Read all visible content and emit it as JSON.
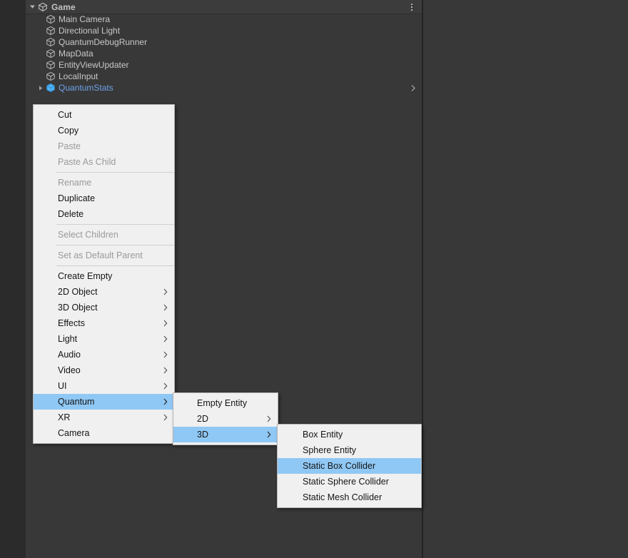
{
  "app": "Unity Editor",
  "hierarchy": {
    "header": {
      "title": "Game",
      "scene_icon": "unity-scene-icon",
      "fold_icon": "triangle-down-icon",
      "options_icon": "kebab-menu-icon"
    },
    "rows": [
      {
        "label": "Main Camera",
        "icon": "gameobject-cube-icon",
        "expandable": false,
        "prefab": false,
        "open_prefab": false
      },
      {
        "label": "Directional Light",
        "icon": "gameobject-cube-icon",
        "expandable": false,
        "prefab": false,
        "open_prefab": false
      },
      {
        "label": "QuantumDebugRunner",
        "icon": "gameobject-cube-icon",
        "expandable": false,
        "prefab": false,
        "open_prefab": false
      },
      {
        "label": "MapData",
        "icon": "gameobject-cube-icon",
        "expandable": false,
        "prefab": false,
        "open_prefab": false
      },
      {
        "label": "EntityViewUpdater",
        "icon": "gameobject-cube-icon",
        "expandable": false,
        "prefab": false,
        "open_prefab": false
      },
      {
        "label": "LocalInput",
        "icon": "gameobject-cube-icon",
        "expandable": false,
        "prefab": false,
        "open_prefab": false
      },
      {
        "label": "QuantumStats",
        "icon": "prefab-cube-icon",
        "expandable": true,
        "prefab": true,
        "open_prefab": true
      }
    ]
  },
  "context_menu": {
    "items": [
      {
        "label": "Cut",
        "state": "enabled",
        "submenu": false
      },
      {
        "label": "Copy",
        "state": "enabled",
        "submenu": false
      },
      {
        "label": "Paste",
        "state": "disabled",
        "submenu": false
      },
      {
        "label": "Paste As Child",
        "state": "disabled",
        "submenu": false
      },
      {
        "separator": true
      },
      {
        "label": "Rename",
        "state": "disabled",
        "submenu": false
      },
      {
        "label": "Duplicate",
        "state": "enabled",
        "submenu": false
      },
      {
        "label": "Delete",
        "state": "enabled",
        "submenu": false
      },
      {
        "separator": true
      },
      {
        "label": "Select Children",
        "state": "disabled",
        "submenu": false
      },
      {
        "separator": true
      },
      {
        "label": "Set as Default Parent",
        "state": "disabled",
        "submenu": false
      },
      {
        "separator": true
      },
      {
        "label": "Create Empty",
        "state": "enabled",
        "submenu": false
      },
      {
        "label": "2D Object",
        "state": "enabled",
        "submenu": true
      },
      {
        "label": "3D Object",
        "state": "enabled",
        "submenu": true
      },
      {
        "label": "Effects",
        "state": "enabled",
        "submenu": true
      },
      {
        "label": "Light",
        "state": "enabled",
        "submenu": true
      },
      {
        "label": "Audio",
        "state": "enabled",
        "submenu": true
      },
      {
        "label": "Video",
        "state": "enabled",
        "submenu": true
      },
      {
        "label": "UI",
        "state": "enabled",
        "submenu": true
      },
      {
        "label": "Quantum",
        "state": "selected",
        "submenu": true
      },
      {
        "label": "XR",
        "state": "enabled",
        "submenu": true
      },
      {
        "label": "Camera",
        "state": "enabled",
        "submenu": false
      }
    ]
  },
  "quantum_submenu": {
    "items": [
      {
        "label": "Empty Entity",
        "state": "enabled",
        "submenu": false
      },
      {
        "label": "2D",
        "state": "enabled",
        "submenu": true
      },
      {
        "label": "3D",
        "state": "selected",
        "submenu": true
      }
    ]
  },
  "threed_submenu": {
    "items": [
      {
        "label": "Box Entity",
        "state": "enabled",
        "submenu": false
      },
      {
        "label": "Sphere Entity",
        "state": "enabled",
        "submenu": false
      },
      {
        "label": "Static Box Collider",
        "state": "selected",
        "submenu": false
      },
      {
        "label": "Static Sphere Collider",
        "state": "enabled",
        "submenu": false
      },
      {
        "label": "Static Mesh Collider",
        "state": "enabled",
        "submenu": false
      }
    ]
  },
  "colors": {
    "editor_bg": "#383838",
    "gutter_bg": "#2b2b2b",
    "header_bg": "#3c3c3c",
    "menu_bg": "#f0f0f0",
    "menu_highlight": "#90c8f5",
    "prefab_text": "#6da2e8",
    "row_text": "#c8c8c8"
  }
}
